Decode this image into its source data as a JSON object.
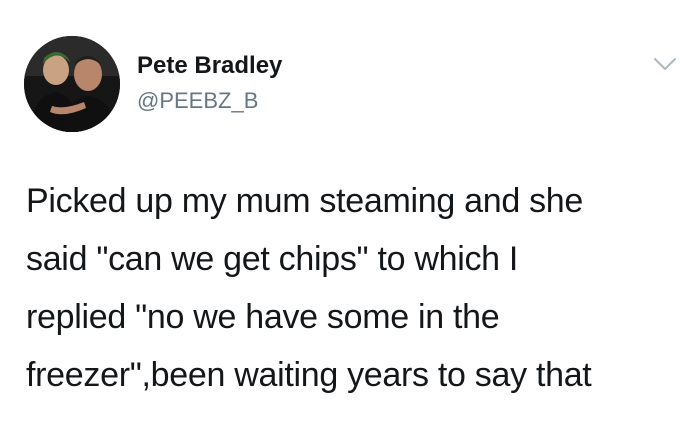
{
  "tweet": {
    "author_name": "Pete Bradley",
    "author_handle": "@PEEBZ_B",
    "avatar_icon": "profile-photo",
    "menu_icon": "chevron-down-icon",
    "text_lines": [
      "Picked up my mum steaming and she",
      "said \"can we get chips\" to which I",
      "replied \"no we have some in the",
      "freezer\",been waiting years to say that"
    ]
  },
  "colors": {
    "name": "#14171a",
    "handle": "#657786",
    "body": "#14171a",
    "chevron": "#aab8c2",
    "background": "#ffffff"
  }
}
